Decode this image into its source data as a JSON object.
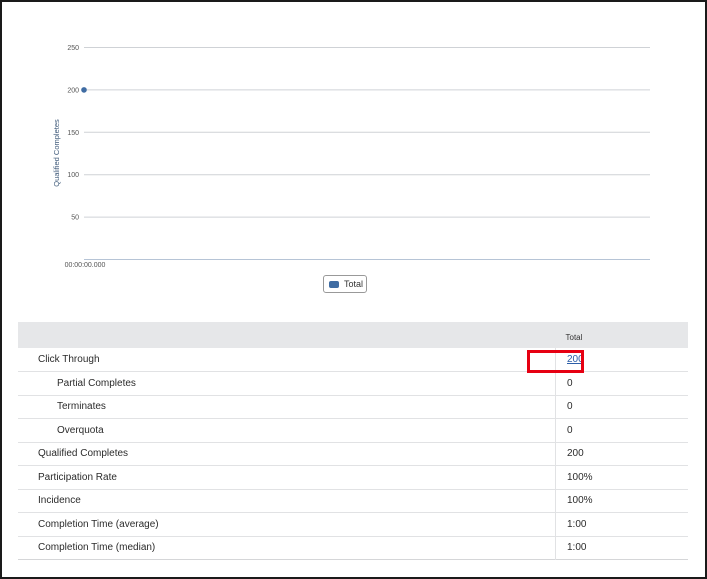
{
  "chart": {
    "y_ticks": [
      "250",
      "200",
      "150",
      "100",
      "50"
    ],
    "x_tick": "00:00:00.000",
    "y_axis_label": "Qualified Completes",
    "legend_label": "Total",
    "accent_color": "#3f6ca3"
  },
  "chart_data": {
    "type": "line",
    "x": [
      "00:00:00.000"
    ],
    "series": [
      {
        "name": "Total",
        "values": [
          200
        ]
      }
    ],
    "ylabel": "Qualified Completes",
    "xlabel": "",
    "ylim": [
      0,
      250
    ],
    "y_ticks": [
      50,
      100,
      150,
      200,
      250
    ],
    "grid": true,
    "legend": "bottom-center"
  },
  "table": {
    "column_header": "Total",
    "rows": [
      {
        "label": "Click Through",
        "value": "200"
      },
      {
        "label": "Partial Completes",
        "value": "0"
      },
      {
        "label": "Terminates",
        "value": "0"
      },
      {
        "label": "Overquota",
        "value": "0"
      },
      {
        "label": "Qualified Completes",
        "value": "200"
      },
      {
        "label": "Participation Rate",
        "value": "100%"
      },
      {
        "label": "Incidence",
        "value": "100%"
      },
      {
        "label": "Completion Time (average)",
        "value": "1:00"
      },
      {
        "label": "Completion Time (median)",
        "value": "1:00"
      }
    ]
  },
  "highlight_color": "#e60012"
}
